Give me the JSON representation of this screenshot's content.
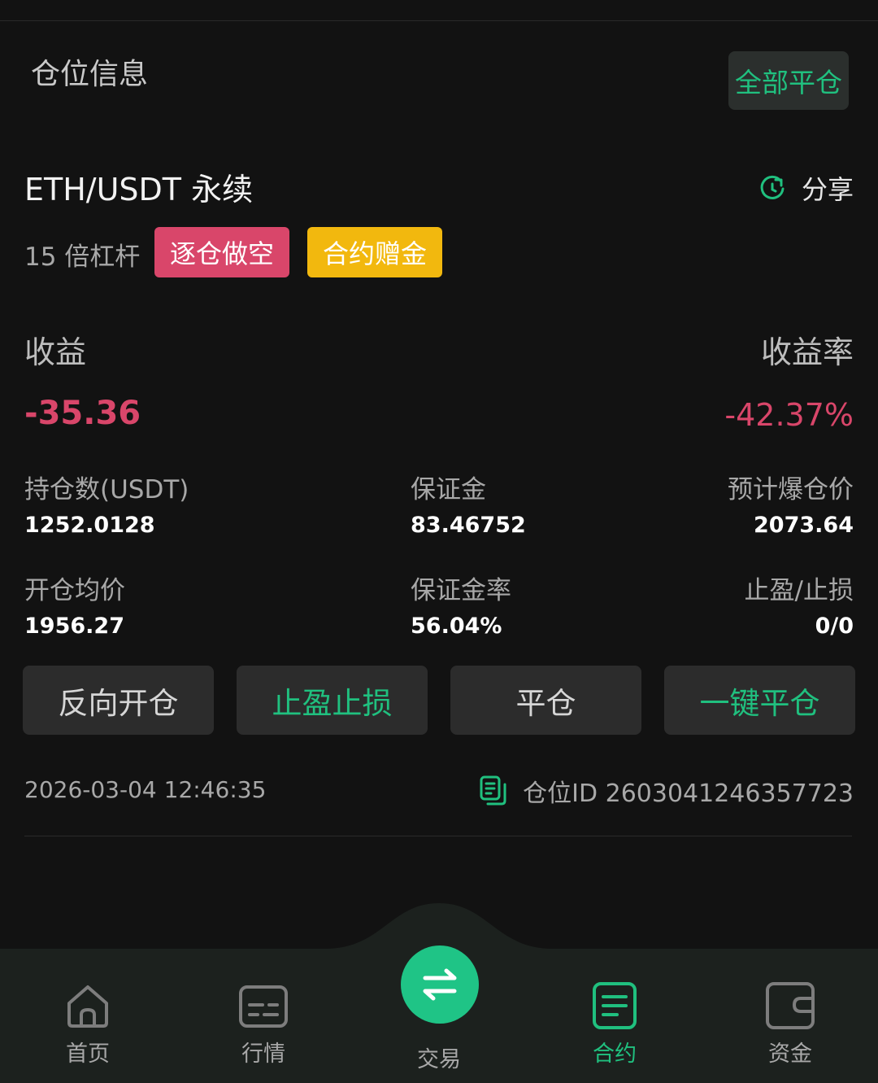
{
  "header": {
    "title": "仓位信息",
    "close_all_label": "全部平仓"
  },
  "position": {
    "pair": "ETH/USDT 永续",
    "share_label": "分享",
    "leverage": "15 倍杠杆",
    "tags": {
      "mode": "逐仓做空",
      "bonus": "合约赠金"
    },
    "pnl_label": "收益",
    "pnl_rate_label": "收益率",
    "pnl": "-35.36",
    "pnl_rate": "-42.37%",
    "stats": [
      {
        "label": "持仓数(USDT)",
        "value": "1252.0128"
      },
      {
        "label": "保证金",
        "value": "83.46752"
      },
      {
        "label": "预计爆仓价",
        "value": "2073.64"
      },
      {
        "label": "开仓均价",
        "value": "1956.27"
      },
      {
        "label": "保证金率",
        "value": "56.04%"
      },
      {
        "label": "止盈/止损",
        "value": "0/0"
      }
    ],
    "actions": [
      "反向开仓",
      "止盈止损",
      "平仓",
      "一键平仓"
    ],
    "timestamp": "2026-03-04 12:46:35",
    "position_id": "仓位ID 2603041246357723"
  },
  "tabbar": {
    "tabs": [
      {
        "label": "首页",
        "icon": "home-icon"
      },
      {
        "label": "行情",
        "icon": "market-icon"
      },
      {
        "label": "交易",
        "icon": "swap-icon"
      },
      {
        "label": "合约",
        "icon": "contract-icon"
      },
      {
        "label": "资金",
        "icon": "wallet-icon"
      }
    ],
    "active": "合约"
  },
  "colors": {
    "accent": "#20c07f",
    "loss": "#d9466a",
    "bonus": "#f2b80e",
    "bg": "#121212"
  }
}
